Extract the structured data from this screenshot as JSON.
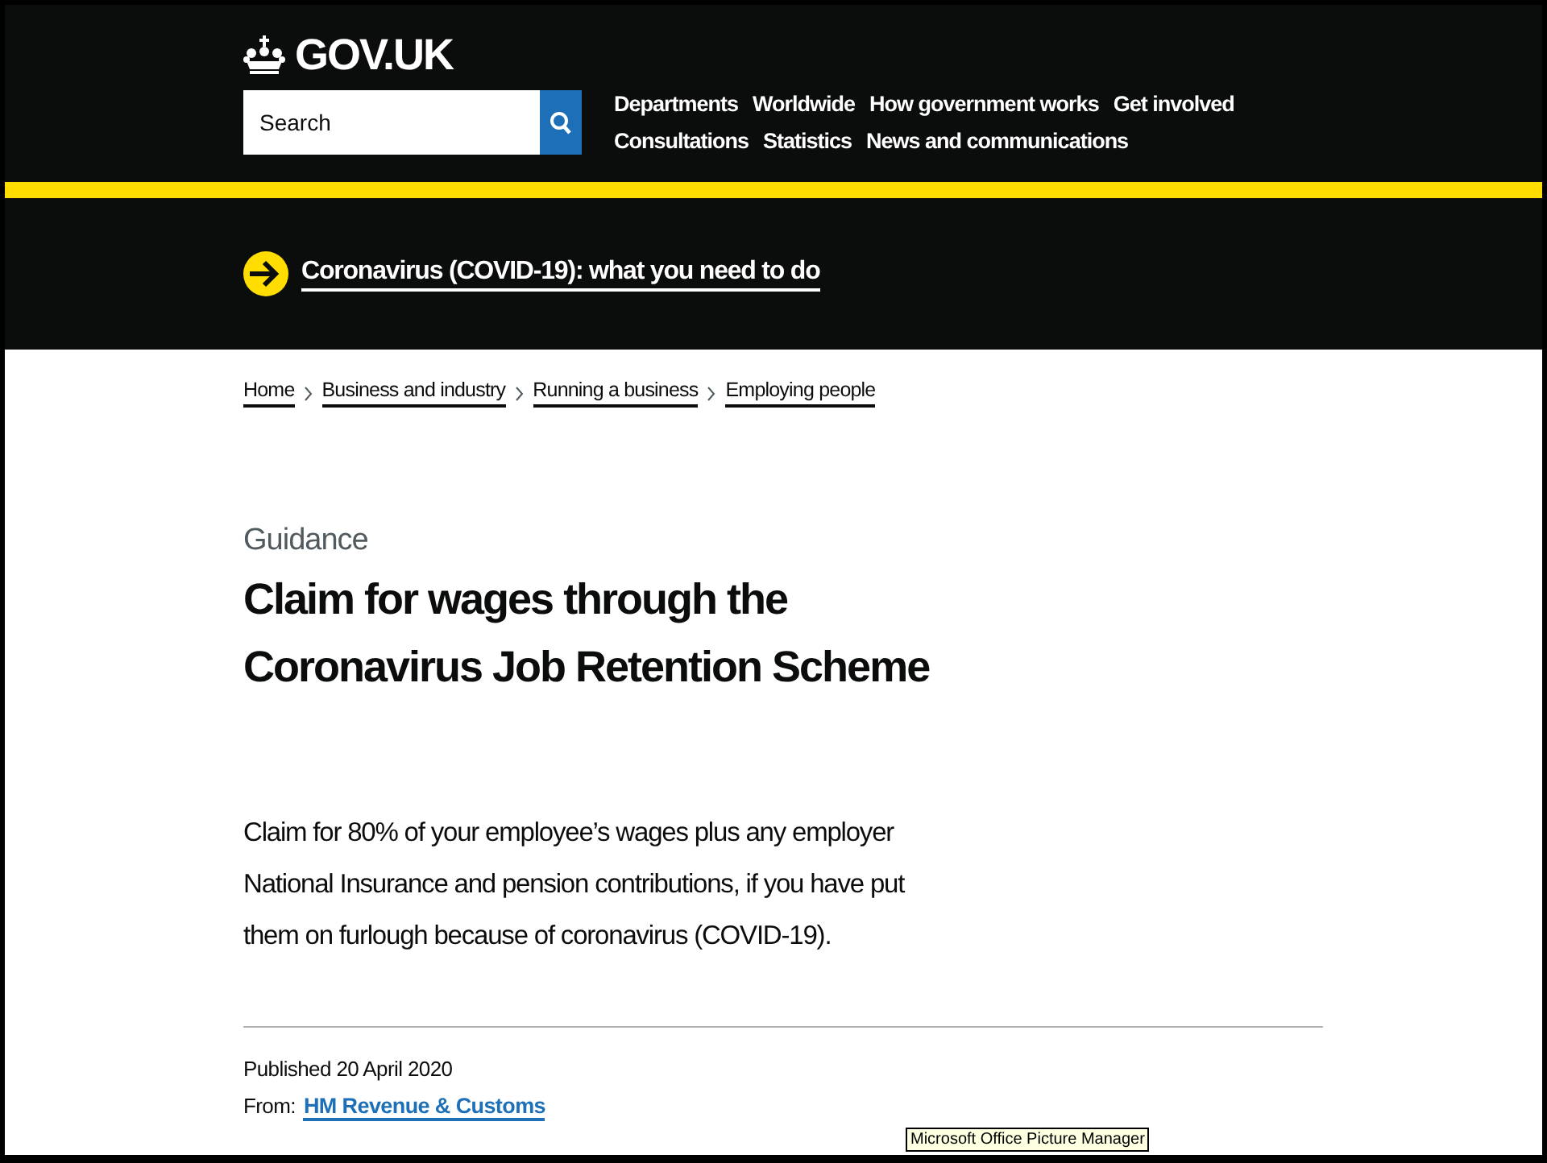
{
  "header": {
    "logo": "GOV.UK",
    "search": {
      "placeholder": "Search"
    },
    "nav": [
      [
        "Departments",
        "Worldwide",
        "How government works",
        "Get involved"
      ],
      [
        "Consultations",
        "Statistics",
        "News and communications"
      ]
    ]
  },
  "banner": {
    "link": "Coronavirus (COVID-19): what you need to do"
  },
  "breadcrumbs": [
    "Home",
    "Business and industry",
    "Running a business",
    "Employing people"
  ],
  "caption": "Guidance",
  "title": "Claim for wages through the Coronavirus Job Retention Scheme",
  "lead": "Claim for 80% of your employee’s wages plus any employer National Insurance and pension contributions, if you have put them on furlough because of coronavirus (COVID-19).",
  "metadata": {
    "published": "Published 20 April 2020",
    "from_label": "From:",
    "from_link": "HM Revenue & Customs"
  },
  "tooltip": "Microsoft Office Picture Manager"
}
